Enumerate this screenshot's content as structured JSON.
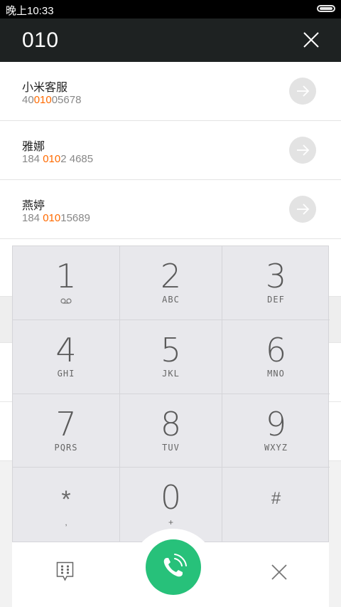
{
  "status_bar": {
    "time": "晚上10:33"
  },
  "search": {
    "query": "010"
  },
  "results": [
    {
      "name": "小米客服",
      "number_pre": "40",
      "number_match": "010",
      "number_post": "05678"
    },
    {
      "name": "雅娜",
      "number_pre": "184 ",
      "number_match": "010",
      "number_post": "2 4685"
    },
    {
      "name": "燕婷",
      "number_pre": "184 ",
      "number_match": "010",
      "number_post": "15689"
    }
  ],
  "keypad": {
    "keys": [
      {
        "digit": "1",
        "letters": ""
      },
      {
        "digit": "2",
        "letters": "ABC"
      },
      {
        "digit": "3",
        "letters": "DEF"
      },
      {
        "digit": "4",
        "letters": "GHI"
      },
      {
        "digit": "5",
        "letters": "JKL"
      },
      {
        "digit": "6",
        "letters": "MNO"
      },
      {
        "digit": "7",
        "letters": "PQRS"
      },
      {
        "digit": "8",
        "letters": "TUV"
      },
      {
        "digit": "9",
        "letters": "WXYZ"
      },
      {
        "digit": "*",
        "letters": ","
      },
      {
        "digit": "0",
        "letters": "+"
      },
      {
        "digit": "#",
        "letters": ""
      }
    ]
  },
  "colors": {
    "highlight": "#ff6a00",
    "call_button": "#27c17a",
    "header_bg": "#1e2222"
  },
  "icons": {
    "voicemail": "voicemail-icon",
    "clear": "close-icon",
    "arrow": "arrow-right-icon",
    "dialpad_toggle": "dialpad-icon",
    "call": "phone-call-icon",
    "delete": "close-icon"
  }
}
